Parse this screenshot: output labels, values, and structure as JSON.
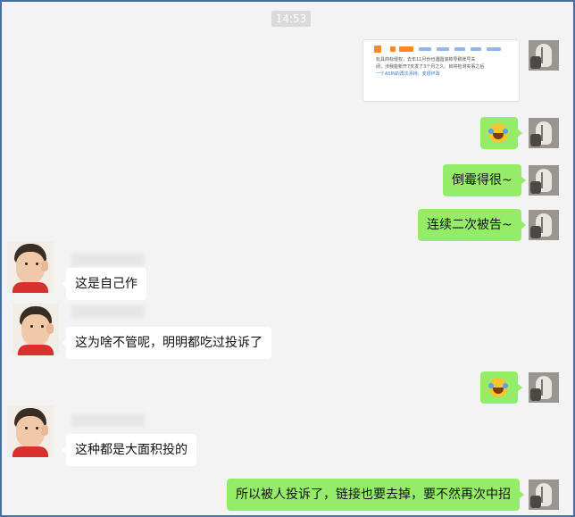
{
  "header": {
    "time": "14:53"
  },
  "self_avatar": {
    "icon": "hand-photo-avatar"
  },
  "contact_avatar": {
    "icon": "child-photo-avatar"
  },
  "messages": [
    {
      "sender": "me",
      "type": "image",
      "lines": [
        "玩具商标侵权，去年11月份也遇圆滚柿导致账号关",
        "闭，涉我能新开7天发了3个月之久。目将检测实事之后",
        "一个ASIN的再次添持。变侵坏政"
      ]
    },
    {
      "sender": "me",
      "type": "emoji",
      "emoji": "laugh-cry-emoji"
    },
    {
      "sender": "me",
      "type": "text",
      "text": "倒霉得很~"
    },
    {
      "sender": "me",
      "type": "text",
      "text": "连续二次被告~"
    },
    {
      "sender": "contact",
      "type": "text",
      "text": "这是自己作"
    },
    {
      "sender": "contact",
      "type": "text",
      "text": "这为啥不管呢，明明都吃过投诉了"
    },
    {
      "sender": "me",
      "type": "emoji",
      "emoji": "laugh-cry-emoji"
    },
    {
      "sender": "contact",
      "type": "text",
      "text": "这种都是大面积投的"
    },
    {
      "sender": "me",
      "type": "text",
      "text": "所以被人投诉了，链接也要去掉，要不然再次中招"
    }
  ],
  "colors": {
    "self_bubble": "#95ec69",
    "contact_bubble": "#ffffff",
    "background": "#f3f3f3",
    "frame_border": "#4a6fa8"
  }
}
